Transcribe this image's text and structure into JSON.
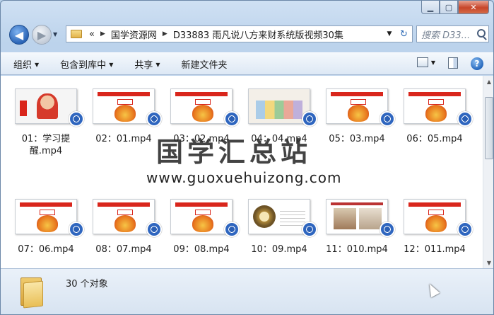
{
  "window": {
    "caption_buttons": [
      "minimize",
      "maximize",
      "close"
    ]
  },
  "address_bar": {
    "overflow": "«",
    "segments": [
      "国学资源网",
      "D33883 雨凡说八方来财系统版视频30集"
    ],
    "search_placeholder": "搜索 D33..."
  },
  "toolbar": {
    "organize": "组织",
    "include_in_library": "包含到库中",
    "share": "共享",
    "new_folder": "新建文件夹"
  },
  "files": [
    {
      "name": "01：学习提醒.mp4",
      "thumb": "person"
    },
    {
      "name": "02：01.mp4",
      "thumb": "mascot"
    },
    {
      "name": "03：02.mp4",
      "thumb": "mascot"
    },
    {
      "name": "04：04.mp4",
      "thumb": "kids"
    },
    {
      "name": "05：03.mp4",
      "thumb": "mascot"
    },
    {
      "name": "06：05.mp4",
      "thumb": "mascot"
    },
    {
      "name": "07：06.mp4",
      "thumb": "mascot"
    },
    {
      "name": "08：07.mp4",
      "thumb": "mascot"
    },
    {
      "name": "09：08.mp4",
      "thumb": "mascot"
    },
    {
      "name": "10：09.mp4",
      "thumb": "compass"
    },
    {
      "name": "11：010.mp4",
      "thumb": "slide"
    },
    {
      "name": "12：011.mp4",
      "thumb": "mascot"
    }
  ],
  "watermark": {
    "title": "国学汇总站",
    "url": "www.guoxuehuizong.com"
  },
  "details": {
    "count": "30 个对象"
  }
}
